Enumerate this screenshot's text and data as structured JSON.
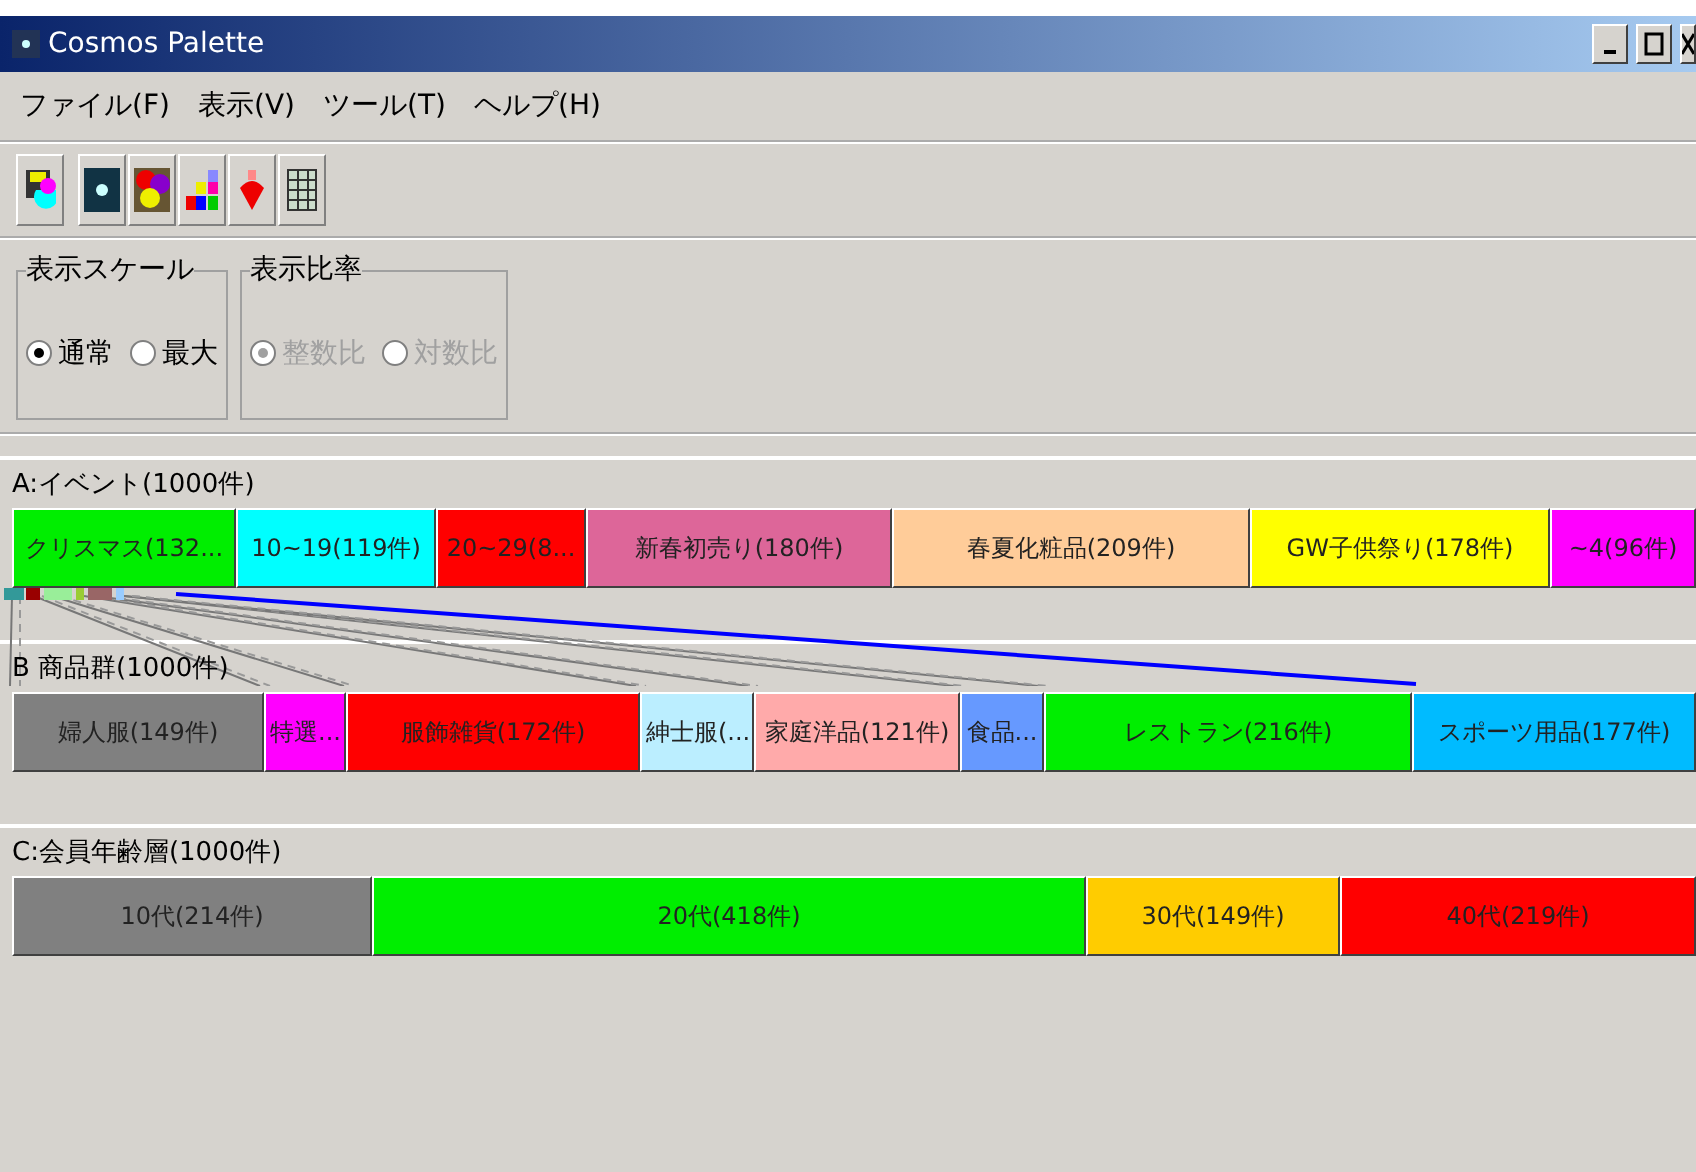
{
  "window": {
    "title": "Cosmos Palette"
  },
  "menu": [
    "ファイル(F)",
    "表示(V)",
    "ツール(T)",
    "ヘルプ(H)"
  ],
  "scale_group": {
    "title": "表示スケール",
    "disabled": false,
    "options": [
      {
        "label": "通常",
        "selected": true
      },
      {
        "label": "最大",
        "selected": false
      }
    ]
  },
  "ratio_group": {
    "title": "表示比率",
    "disabled": true,
    "options": [
      {
        "label": "整数比",
        "selected": true
      },
      {
        "label": "対数比",
        "selected": false
      }
    ]
  },
  "sections": [
    {
      "title": "A:イベント(1000件)",
      "segments": [
        {
          "label": "クリスマス(132...",
          "color": "#00ee00"
        },
        {
          "label": "10~19(119件)",
          "color": "#00ffff"
        },
        {
          "label": "20~29(8...",
          "color": "#ff0000"
        },
        {
          "label": "新春初売り(180件)",
          "color": "#dd6699"
        },
        {
          "label": "春夏化粧品(209件)",
          "color": "#ffcc99"
        },
        {
          "label": "GW子供祭り(178件)",
          "color": "#ffff00"
        },
        {
          "label": "~4(96件)",
          "color": "#ff00ff"
        }
      ]
    },
    {
      "title": "B 商品群(1000件)",
      "segments": [
        {
          "label": "婦人服(149件)",
          "color": "#808080"
        },
        {
          "label": "特選...",
          "color": "#ff00ff"
        },
        {
          "label": "服飾雑貨(172件)",
          "color": "#ff0000"
        },
        {
          "label": "紳士服(...",
          "color": "#bbeeff"
        },
        {
          "label": "家庭洋品(121件)",
          "color": "#ffaaaa"
        },
        {
          "label": "食品...",
          "color": "#6699ff"
        },
        {
          "label": "レストラン(216件)",
          "color": "#00ee00"
        },
        {
          "label": "スポーツ用品(177件)",
          "color": "#00bbff"
        }
      ]
    },
    {
      "title": "C:会員年齢層(1000件)",
      "segments": [
        {
          "label": "10代(214件)",
          "color": "#808080"
        },
        {
          "label": "20代(418件)",
          "color": "#00ee00"
        },
        {
          "label": "30代(149件)",
          "color": "#ffcc00"
        },
        {
          "label": "40代(219件)",
          "color": "#ff0000"
        }
      ]
    }
  ]
}
